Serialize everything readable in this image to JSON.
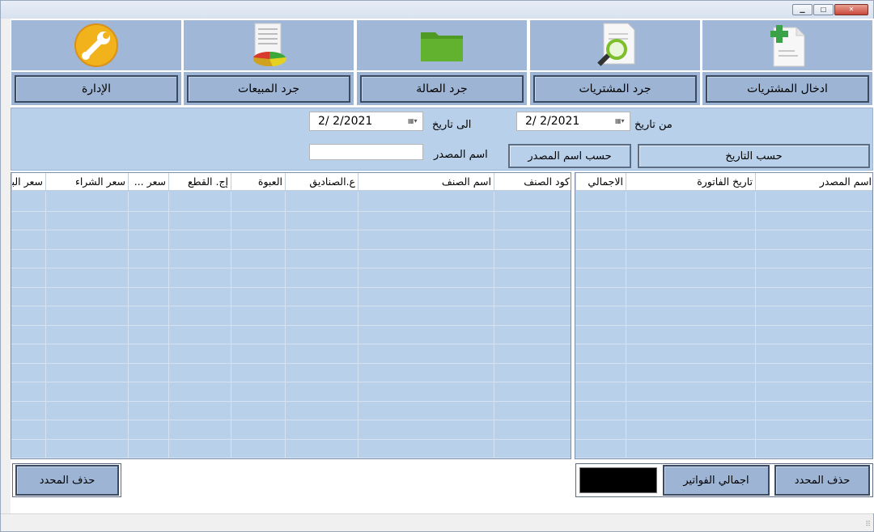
{
  "window": {
    "caption_buttons": [
      "minimize-icon",
      "maximize-icon",
      "close-icon"
    ]
  },
  "tiles": [
    {
      "label": "ادخال المشتريات",
      "icon": "add-document-icon"
    },
    {
      "label": "جرد المشتريات",
      "icon": "magnifier-document-icon"
    },
    {
      "label": "جرد الصالة",
      "icon": "folder-icon"
    },
    {
      "label": "جرد المبيعات",
      "icon": "report-chart-icon"
    },
    {
      "label": "الإدارة",
      "icon": "wrench-icon"
    }
  ],
  "filters": {
    "from_label": "من تاريخ",
    "from_date": "2/  2/2021",
    "to_label": "الى تاريخ",
    "to_date": "2/  2/2021",
    "source_label": "اسم المصدر",
    "source_value": "",
    "by_date_button": "حسب التاريخ",
    "by_source_button": "حسب اسم المصدر"
  },
  "invoices_grid": {
    "columns": [
      "اسم المصدر",
      "تاريخ الفاتورة",
      "الاجمالي"
    ]
  },
  "items_grid": {
    "columns": [
      "كود الصنف",
      "اسم الصنف",
      "ع.الصناديق",
      "العبوة",
      "إج. القطع",
      "سعر ...",
      "سعر الشراء",
      "سعر البيع"
    ]
  },
  "bottom": {
    "delete_selected_right": "حذف المحدد",
    "invoices_total_button": "اجمالي الفواتير",
    "total_value": "",
    "delete_selected_left": "حذف المحدد"
  }
}
